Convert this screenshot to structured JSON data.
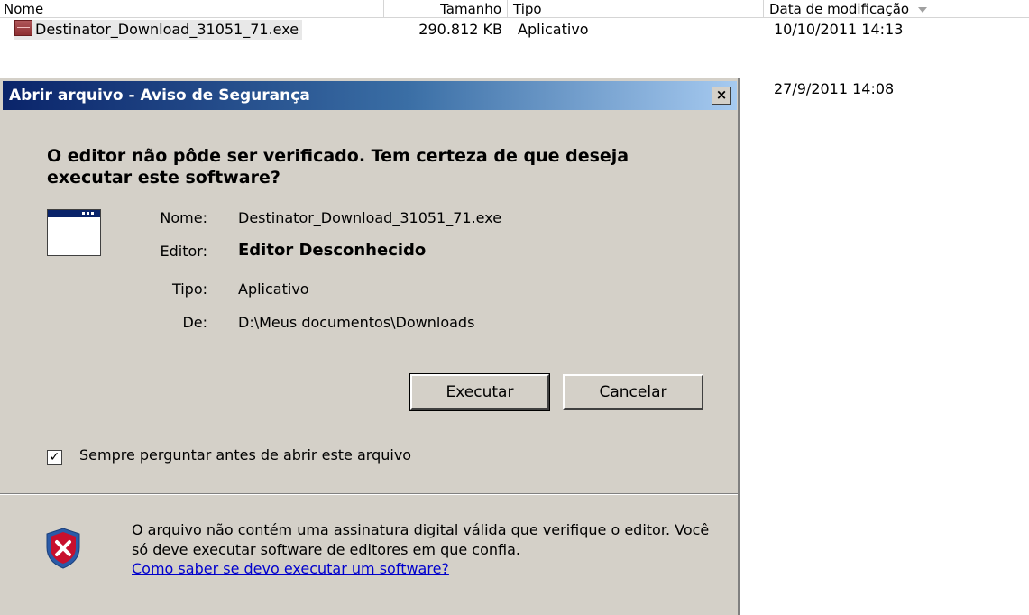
{
  "explorer": {
    "columns": {
      "name": "Nome",
      "size": "Tamanho",
      "type": "Tipo",
      "date": "Data de modificação"
    },
    "rows": [
      {
        "name": "Destinator_Download_31051_71.exe",
        "size": "290.812 KB",
        "type": "Aplicativo",
        "date": "10/10/2011 14:13"
      },
      {
        "date": "27/9/2011 14:08"
      }
    ]
  },
  "dialog": {
    "title": "Abrir arquivo - Aviso de Segurança",
    "close_label": "×",
    "headline": "O editor não pôde ser verificado. Tem certeza de que deseja executar este software?",
    "fields": {
      "name_label": "Nome:",
      "name_value": "Destinator_Download_31051_71.exe",
      "publisher_label": "Editor:",
      "publisher_value": "Editor Desconhecido",
      "type_label": "Tipo:",
      "type_value": "Aplicativo",
      "from_label": "De:",
      "from_value": "D:\\Meus documentos\\Downloads"
    },
    "buttons": {
      "run": "Executar",
      "cancel": "Cancelar"
    },
    "checkbox": {
      "label": "Sempre perguntar antes de abrir este arquivo",
      "checked": true,
      "mark": "✓"
    },
    "warning_text": "O arquivo não contém uma assinatura digital válida que verifique o editor. Você só deve executar software de editores em que confia.",
    "help_link": "Como saber se devo executar um software?"
  },
  "colors": {
    "title_start": "#0a246a",
    "title_end": "#a6caf0",
    "dialog_bg": "#d4d0c8",
    "shield_red": "#c8102e"
  }
}
